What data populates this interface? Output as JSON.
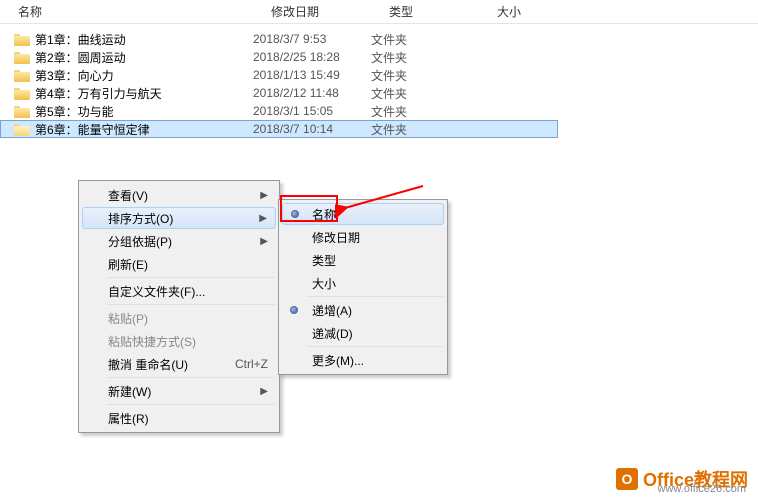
{
  "columns": {
    "name": "名称",
    "date": "修改日期",
    "type": "类型",
    "size": "大小"
  },
  "files": [
    {
      "name": "第1章：曲线运动",
      "date": "2018/3/7 9:53",
      "type": "文件夹"
    },
    {
      "name": "第2章：圆周运动",
      "date": "2018/2/25 18:28",
      "type": "文件夹"
    },
    {
      "name": "第3章：向心力",
      "date": "2018/1/13 15:49",
      "type": "文件夹"
    },
    {
      "name": "第4章：万有引力与航天",
      "date": "2018/2/12 11:48",
      "type": "文件夹"
    },
    {
      "name": "第5章：功与能",
      "date": "2018/3/1 15:05",
      "type": "文件夹"
    },
    {
      "name": "第6章：能量守恒定律",
      "date": "2018/3/7 10:14",
      "type": "文件夹"
    }
  ],
  "menu": {
    "view": "查看(V)",
    "sort": "排序方式(O)",
    "group": "分组依据(P)",
    "refresh": "刷新(E)",
    "customize": "自定义文件夹(F)...",
    "paste": "粘贴(P)",
    "pasteShortcut": "粘贴快捷方式(S)",
    "undoRename": "撤消 重命名(U)",
    "undoShortcut": "Ctrl+Z",
    "new": "新建(W)",
    "properties": "属性(R)"
  },
  "submenu": {
    "name": "名称",
    "date": "修改日期",
    "type": "类型",
    "size": "大小",
    "ascending": "递增(A)",
    "descending": "递减(D)",
    "more": "更多(M)..."
  },
  "watermark": {
    "brand": "Office教程网",
    "url": "www.office26.com"
  }
}
